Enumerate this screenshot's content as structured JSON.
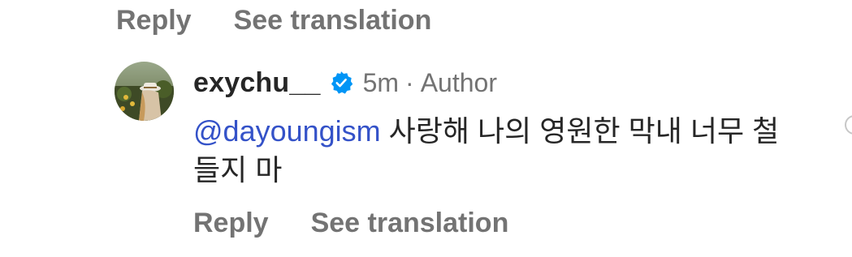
{
  "previous_comment": {
    "actions": {
      "reply_label": "Reply",
      "translate_label": "See translation"
    }
  },
  "comment": {
    "username": "exychu__",
    "verified_icon": "verified-badge-icon",
    "time": "5m",
    "separator": "·",
    "role": "Author",
    "mention": "@dayoungism",
    "text": " 사랑해 나의 영원한 막내 너무 철들지 마",
    "actions": {
      "reply_label": "Reply",
      "translate_label": "See translation"
    }
  },
  "colors": {
    "mention": "#3452c8",
    "verified": "#0095f6",
    "secondary_text": "#737373",
    "primary_text": "#262626"
  }
}
